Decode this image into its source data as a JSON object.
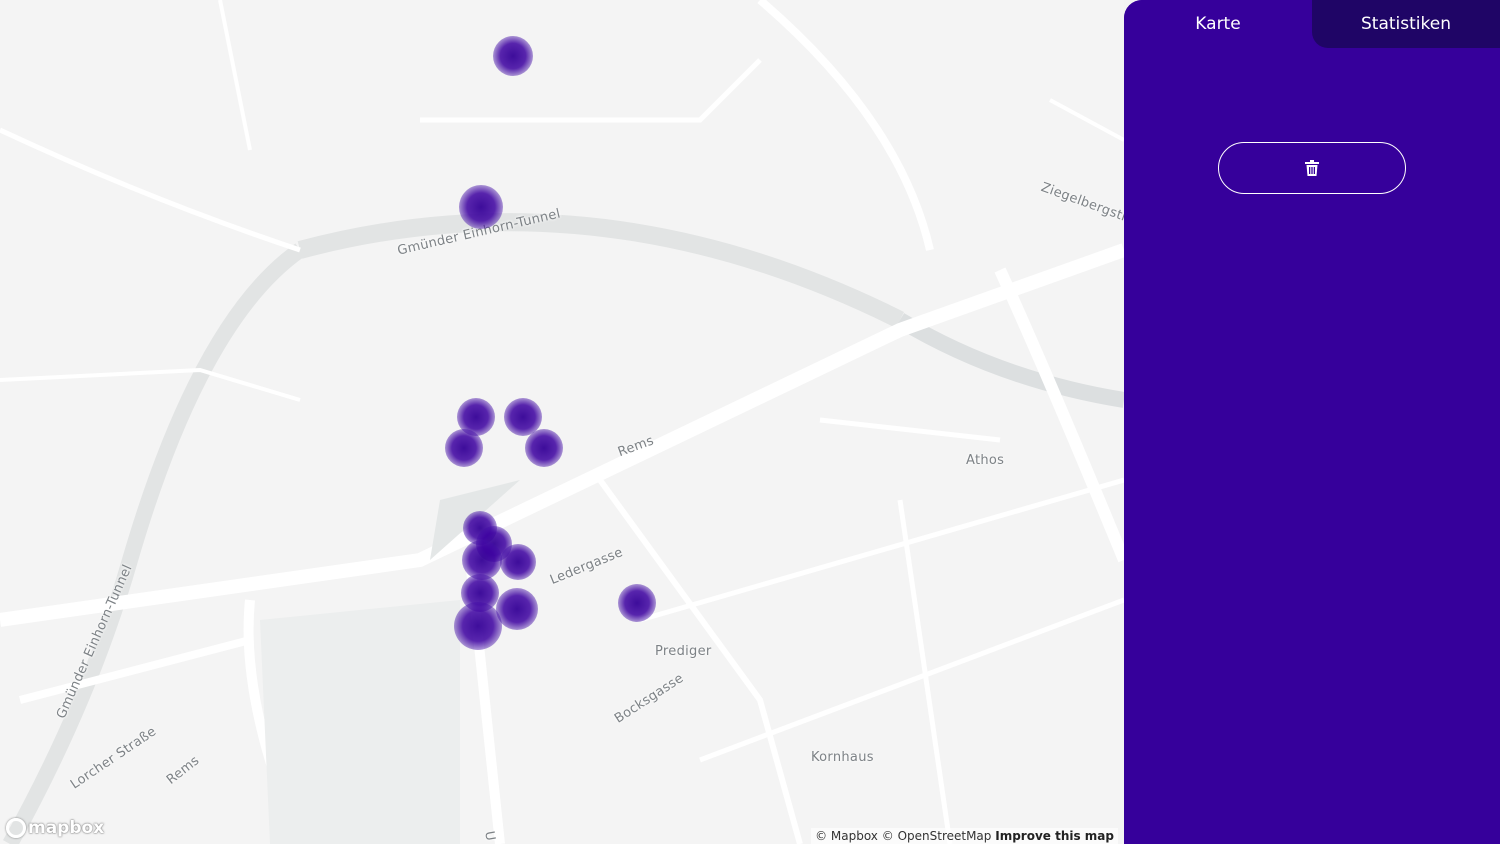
{
  "map": {
    "labels": {
      "tunnel_top": "Gmünder Einhorn-Tunnel",
      "tunnel_left": "Gmünder Einhorn-Tunnel",
      "rems_river": "Rems",
      "rems_river_2": "Rems",
      "ledergasse": "Ledergasse",
      "prediger": "Prediger",
      "bocksgasse": "Bocksgasse",
      "kornhaus": "Kornhaus",
      "athos": "Athos",
      "lorcher": "Lorcher Straße",
      "ziegelberg": "Ziegelbergstr",
      "u_street": "U"
    },
    "heat_color": "#3a0096",
    "attribution": {
      "mapbox": "© Mapbox",
      "osm": "© OpenStreetMap",
      "improve": "Improve this map"
    },
    "logo_text": "mapbox"
  },
  "panel": {
    "background": "#36009b",
    "tabs": [
      {
        "label": "Karte",
        "active": true
      },
      {
        "label": "Statistiken",
        "active": false
      }
    ],
    "trash_icon": "trash-icon"
  }
}
